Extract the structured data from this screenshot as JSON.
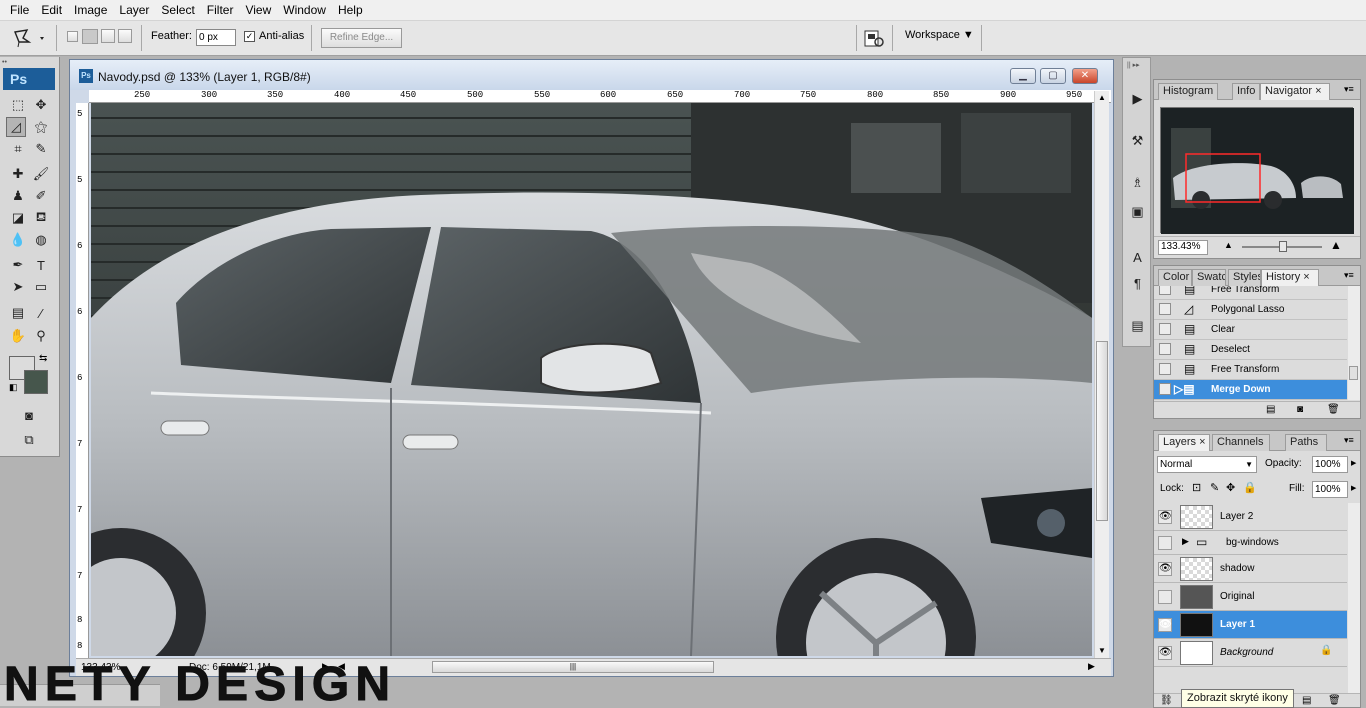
{
  "menu": [
    "File",
    "Edit",
    "Image",
    "Layer",
    "Select",
    "Filter",
    "View",
    "Window",
    "Help"
  ],
  "options": {
    "feather_label": "Feather:",
    "feather_value": "0 px",
    "antialias_label": "Anti-alias",
    "antialias_checked": true,
    "refine_label": "Refine Edge...",
    "workspace_label": "Workspace"
  },
  "toolbox": {
    "logo": "Ps"
  },
  "document": {
    "title": "Navody.psd @ 133% (Layer 1, RGB/8#)",
    "ruler_h": [
      "250",
      "300",
      "350",
      "400",
      "450",
      "500",
      "550",
      "600",
      "650",
      "700",
      "750",
      "800",
      "850",
      "900",
      "950"
    ],
    "ruler_v": [
      "5",
      "5",
      "6",
      "6",
      "6",
      "7",
      "7",
      "7",
      "8",
      "8"
    ],
    "zoom": "133.43%",
    "doc_info": "Doc: 6,59M/21,1M"
  },
  "navigator": {
    "tabs": [
      "Histogram",
      "Info",
      "Navigator"
    ],
    "active_tab": "Navigator",
    "zoom": "133.43%"
  },
  "history": {
    "tabs": [
      "Color",
      "Swatc",
      "Styles",
      "History"
    ],
    "active_tab": "History",
    "items": [
      {
        "label": "Free Transform",
        "selected": false
      },
      {
        "label": "Polygonal Lasso",
        "selected": false
      },
      {
        "label": "Clear",
        "selected": false
      },
      {
        "label": "Deselect",
        "selected": false
      },
      {
        "label": "Free Transform",
        "selected": false
      },
      {
        "label": "Merge Down",
        "selected": true
      }
    ]
  },
  "layers": {
    "tabs": [
      "Layers",
      "Channels",
      "Paths"
    ],
    "active_tab": "Layers",
    "blend_mode": "Normal",
    "opacity_label": "Opacity:",
    "opacity": "100%",
    "lock_label": "Lock:",
    "fill_label": "Fill:",
    "fill": "100%",
    "items": [
      {
        "label": "Layer 2",
        "visible": true,
        "selected": false
      },
      {
        "label": "bg-windows",
        "visible": false,
        "selected": false,
        "group": true
      },
      {
        "label": "shadow",
        "visible": true,
        "selected": false
      },
      {
        "label": "Original",
        "visible": false,
        "selected": false
      },
      {
        "label": "Layer 1",
        "visible": true,
        "selected": true
      },
      {
        "label": "Background",
        "visible": true,
        "selected": false,
        "locked": true
      }
    ]
  },
  "tooltip": "Zobrazit skryté ikony",
  "watermark": "NETY DESIGN"
}
